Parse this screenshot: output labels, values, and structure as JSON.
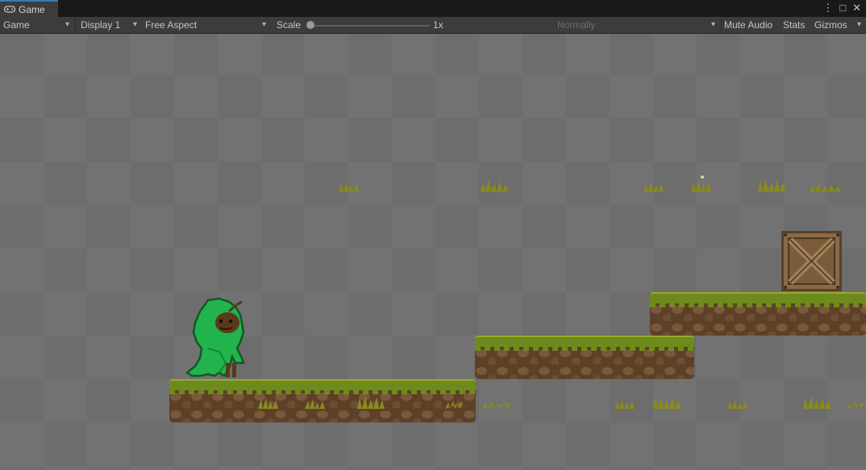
{
  "tab": {
    "icon": "gamepad-icon",
    "label": "Game"
  },
  "window_icons": {
    "menu": "⋮",
    "maximize": "□",
    "close": "✕"
  },
  "toolbar": {
    "view_mode": "Game",
    "display": "Display 1",
    "aspect": "Free Aspect",
    "scale_label": "Scale",
    "scale_value": "1x",
    "play_focus": "Normally",
    "mute_audio": "Mute Audio",
    "stats": "Stats",
    "gizmos": "Gizmos"
  },
  "colors": {
    "accent_tab": "#3a79bb",
    "toolbar_bg": "#3c3c3c",
    "grass": "#6f8a1c",
    "dirt": "#5c4128",
    "hood": "#22b34c",
    "crate": "#8a6a44"
  }
}
